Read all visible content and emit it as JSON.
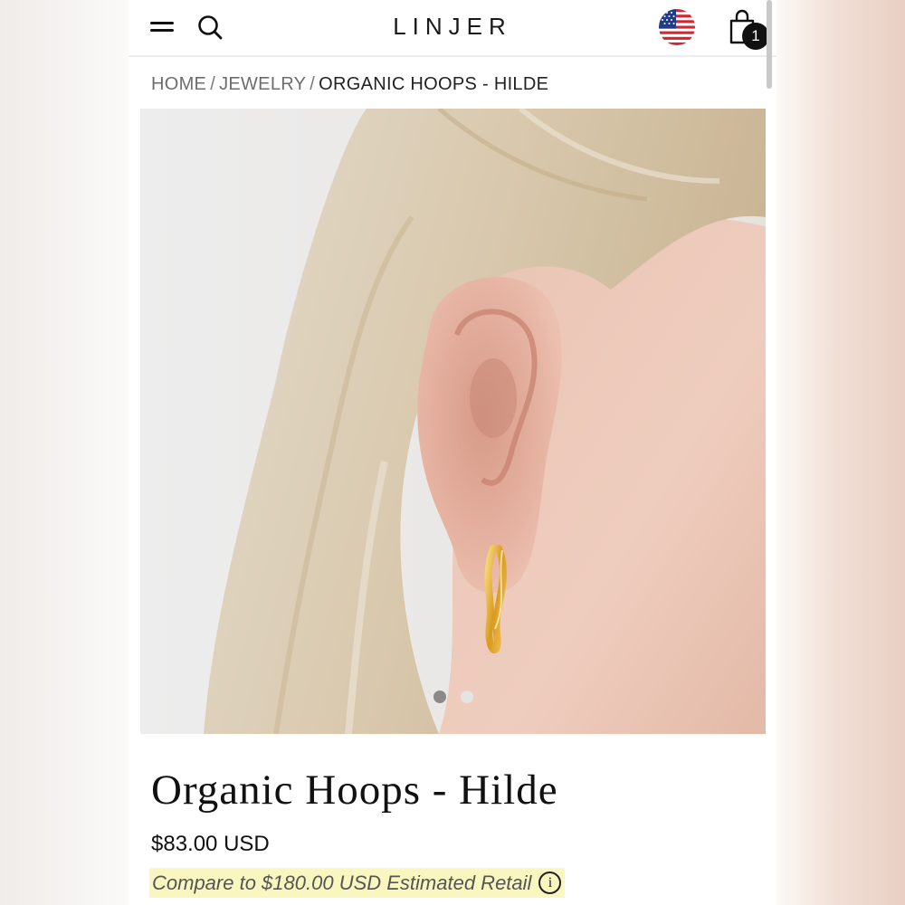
{
  "header": {
    "brand": "LINJER",
    "cart_count": "1",
    "icons": [
      "menu-icon",
      "search-icon",
      "us-flag-icon",
      "shopping-bag-icon"
    ]
  },
  "breadcrumb": {
    "items": [
      {
        "label": "HOME"
      },
      {
        "label": "JEWELRY"
      }
    ],
    "separator": "/",
    "current": "ORGANIC HOOPS - HILDE"
  },
  "gallery": {
    "image_alt": "Organic Hoops - Hilde",
    "dots": [
      {
        "active": false,
        "color": "#8a8a8a"
      },
      {
        "active": true,
        "color": "#e4e4e4"
      }
    ]
  },
  "product": {
    "title": "Organic Hoops - Hilde",
    "price": "$83.00 USD",
    "compare": "Compare to $180.00 USD Estimated Retail",
    "info_glyph": "i"
  },
  "colors": {
    "highlight": "#faf6bf",
    "text": "#111111",
    "muted": "#6d6d6d"
  }
}
